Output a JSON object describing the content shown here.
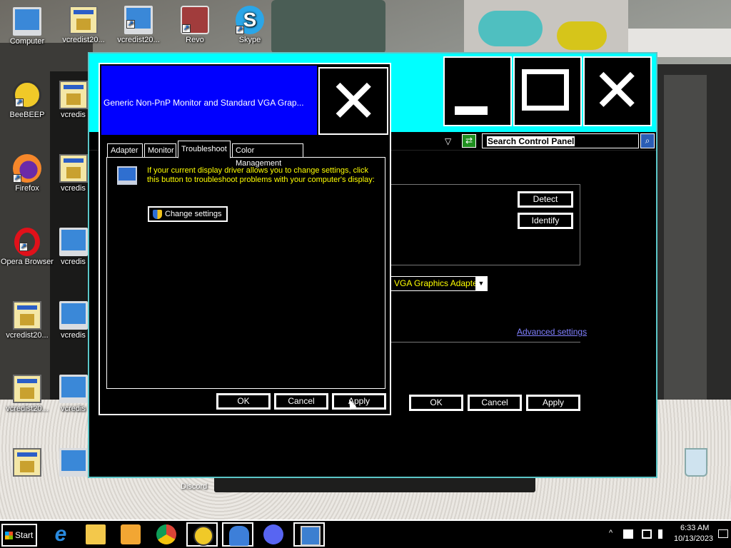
{
  "desktop": {
    "icons": [
      {
        "label": "Computer"
      },
      {
        "label": "vcredist20..."
      },
      {
        "label": "vcredist20..."
      },
      {
        "label": "Revo"
      },
      {
        "label": "Skype"
      },
      {
        "label": "BeeBEEP"
      },
      {
        "label": "vcredis"
      },
      {
        "label": "Firefox"
      },
      {
        "label": "vcredis"
      },
      {
        "label": "Opera Browser"
      },
      {
        "label": "vcredis"
      },
      {
        "label": "vcredist20..."
      },
      {
        "label": "vcredis"
      },
      {
        "label": "vcredist20..."
      },
      {
        "label": "vcredis"
      },
      {
        "label": "Discord"
      }
    ]
  },
  "control_panel": {
    "search_placeholder": "Search Control Panel",
    "detect_label": "Detect",
    "identify_label": "Identify",
    "display_adapter_value": "VGA Graphics Adapter",
    "advanced_settings_link": "Advanced settings",
    "ok_label": "OK",
    "cancel_label": "Cancel",
    "apply_label": "Apply"
  },
  "dialog": {
    "title": "Generic Non-PnP Monitor and Standard VGA Grap...",
    "tabs": [
      {
        "label": "Adapter"
      },
      {
        "label": "Monitor"
      },
      {
        "label": "Troubleshoot"
      },
      {
        "label": "Color Management"
      }
    ],
    "active_tab": "Troubleshoot",
    "troubleshoot_text": "If your current display driver allows you to change settings, click this button to troubleshoot problems with your computer's display:",
    "change_settings_label": "Change settings",
    "ok_label": "OK",
    "cancel_label": "Cancel",
    "apply_label": "Apply"
  },
  "taskbar": {
    "start_label": "Start",
    "apps": [
      "internet-explorer-icon",
      "file-explorer-icon",
      "media-player-icon",
      "chrome-icon",
      "beebeep-icon",
      "bird-app-icon",
      "discord-icon",
      "control-panel-icon"
    ],
    "clock_time": "6:33 AM",
    "clock_date": "10/13/2023"
  },
  "colors": {
    "window_frame": "#00ffff",
    "dialog_title_bg": "#0000ff",
    "instruction_text": "#ffff00",
    "link": "#8080ff"
  }
}
